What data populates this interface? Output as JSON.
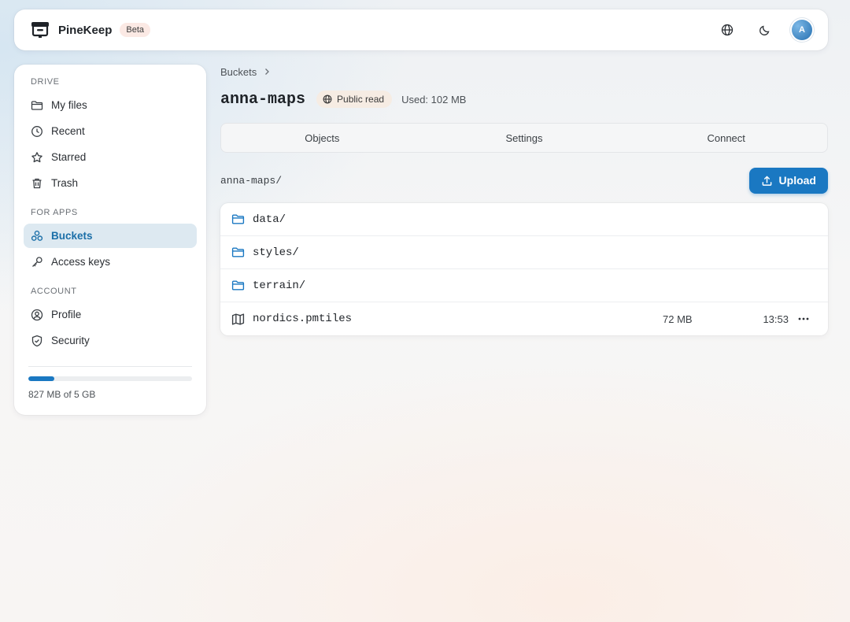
{
  "app": {
    "name": "PineKeep",
    "badge": "Beta"
  },
  "topbar": {
    "avatar_initial": "A"
  },
  "sidebar": {
    "sections": [
      {
        "label": "DRIVE",
        "items": [
          "My files",
          "Recent",
          "Starred",
          "Trash"
        ]
      },
      {
        "label": "FOR APPS",
        "items": [
          "Buckets",
          "Access keys"
        ]
      },
      {
        "label": "ACCOUNT",
        "items": [
          "Profile",
          "Security"
        ]
      }
    ],
    "active_item": "Buckets",
    "storage": {
      "text": "827 MB of 5 GB",
      "fraction_used": 0.16
    }
  },
  "main": {
    "breadcrumb": "Buckets",
    "title": "anna-maps",
    "access_badge": "Public read",
    "used": "Used: 102 MB",
    "tabs": [
      "Objects",
      "Settings",
      "Connect"
    ],
    "path": "anna-maps/",
    "upload_label": "Upload",
    "files": [
      {
        "name": "data/",
        "type": "folder",
        "size": "",
        "time": ""
      },
      {
        "name": "styles/",
        "type": "folder",
        "size": "",
        "time": ""
      },
      {
        "name": "terrain/",
        "type": "folder",
        "size": "",
        "time": ""
      },
      {
        "name": "nordics.pmtiles",
        "type": "map",
        "size": "72 MB",
        "time": "13:53"
      }
    ]
  },
  "colors": {
    "accent": "#1a78c2",
    "active_bg": "#dde9f1"
  }
}
